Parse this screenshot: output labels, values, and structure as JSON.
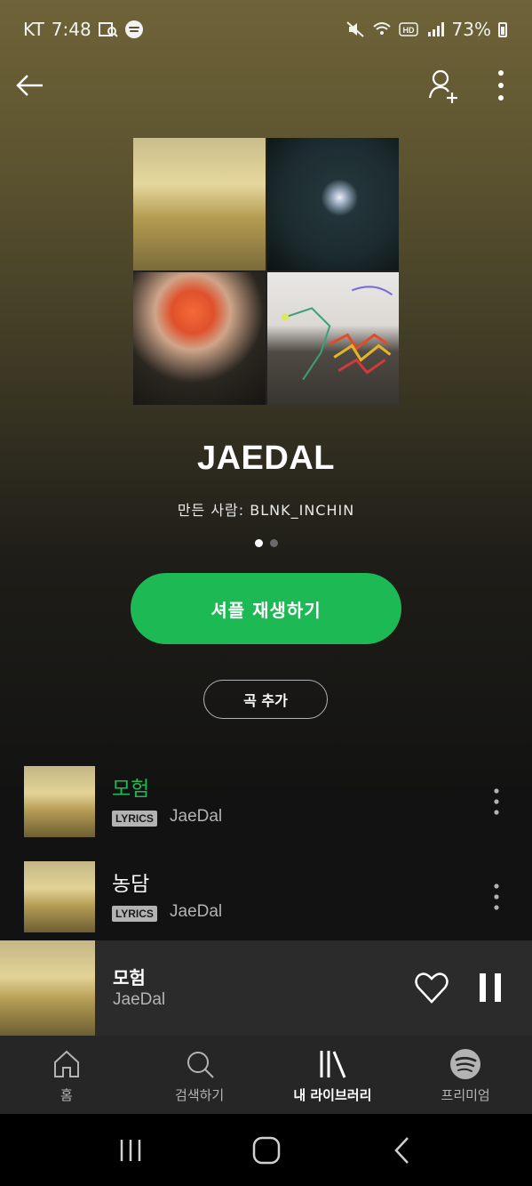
{
  "status_bar": {
    "carrier": "KT",
    "time": "7:48",
    "battery": "73%"
  },
  "playlist": {
    "title": "JAEDAL",
    "creator": "만든 사람: BLNK_INCHIN",
    "shuffle_label": "셔플 재생하기",
    "add_song_label": "곡 추가"
  },
  "tracks": [
    {
      "title": "모험",
      "badge": "LYRICS",
      "artist": "JaeDal",
      "playing": true
    },
    {
      "title": "농담",
      "badge": "LYRICS",
      "artist": "JaeDal",
      "playing": false
    }
  ],
  "now_playing": {
    "title": "모험",
    "artist": "JaeDal"
  },
  "bottom_nav": {
    "items": [
      {
        "label": "홈",
        "icon": "home-icon"
      },
      {
        "label": "검색하기",
        "icon": "search-icon"
      },
      {
        "label": "내 라이브러리",
        "icon": "library-icon"
      },
      {
        "label": "프리미엄",
        "icon": "spotify-icon"
      }
    ],
    "active_index": 2
  },
  "colors": {
    "accent": "#1db954",
    "background": "#121212"
  }
}
